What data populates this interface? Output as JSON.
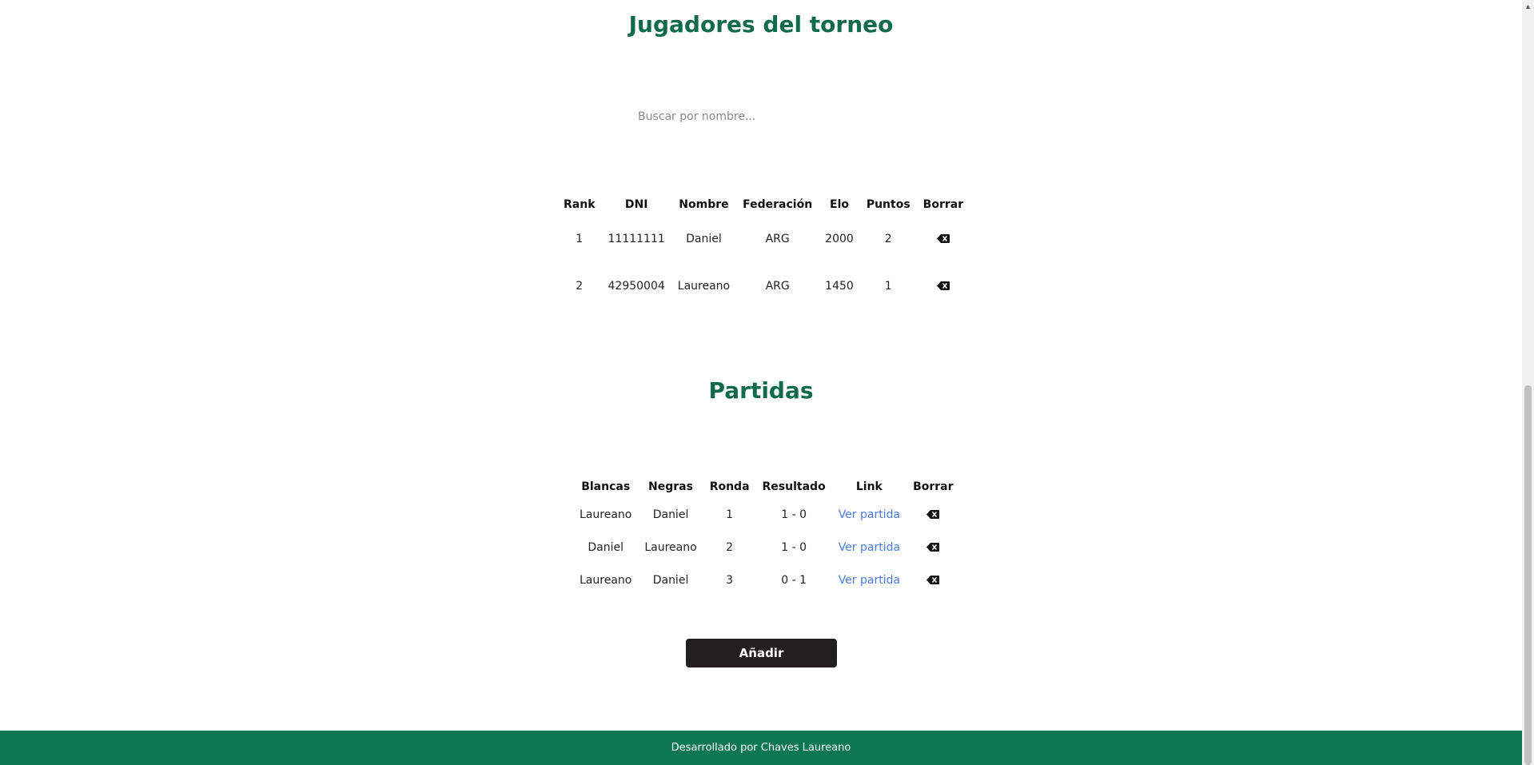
{
  "players_section": {
    "title": "Jugadores del torneo",
    "search_placeholder": "Buscar por nombre...",
    "columns": [
      "Rank",
      "DNI",
      "Nombre",
      "Federación",
      "Elo",
      "Puntos",
      "Borrar"
    ],
    "rows": [
      {
        "rank": "1",
        "dni": "11111111",
        "nombre": "Daniel",
        "federacion": "ARG",
        "elo": "2000",
        "puntos": "2",
        "delete_icon": "delete-backspace-icon"
      },
      {
        "rank": "2",
        "dni": "42950004",
        "nombre": "Laureano",
        "federacion": "ARG",
        "elo": "1450",
        "puntos": "1",
        "delete_icon": "delete-backspace-icon"
      }
    ]
  },
  "games_section": {
    "title": "Partidas",
    "columns": [
      "Blancas",
      "Negras",
      "Ronda",
      "Resultado",
      "Link",
      "Borrar"
    ],
    "rows": [
      {
        "blancas": "Laureano",
        "negras": "Daniel",
        "ronda": "1",
        "resultado": "1 - 0",
        "link": "Ver partida",
        "delete_icon": "delete-backspace-icon"
      },
      {
        "blancas": "Daniel",
        "negras": "Laureano",
        "ronda": "2",
        "resultado": "1 - 0",
        "link": "Ver partida",
        "delete_icon": "delete-backspace-icon"
      },
      {
        "blancas": "Laureano",
        "negras": "Daniel",
        "ronda": "3",
        "resultado": "0 - 1",
        "link": "Ver partida",
        "delete_icon": "delete-backspace-icon"
      }
    ],
    "add_button": "Añadir"
  },
  "footer": {
    "text": "Desarrollado por Chaves Laureano"
  },
  "colors": {
    "title": "#0f6b4c",
    "footer_bg": "#0b7853",
    "link": "#4b7be0",
    "button_bg": "#231f20"
  }
}
